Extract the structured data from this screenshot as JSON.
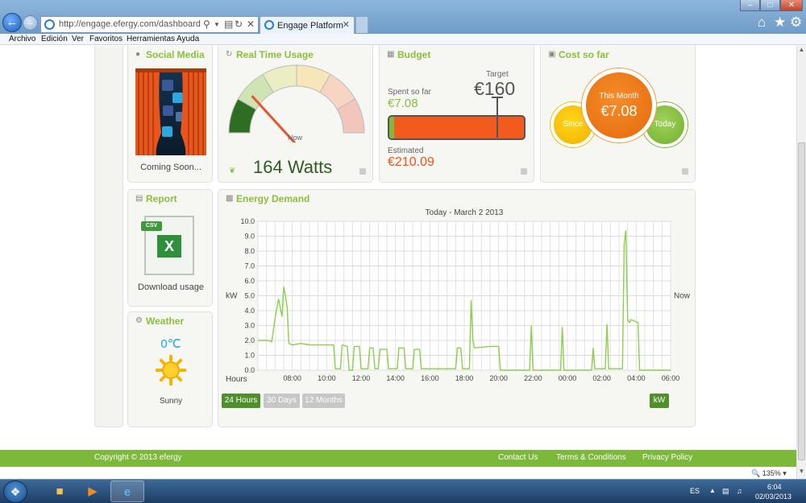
{
  "browser": {
    "url": "http://engage.efergy.com/dashboard",
    "tab_title": "Engage Platform",
    "menu": [
      "Archivo",
      "Edición",
      "Ver",
      "Favoritos",
      "Herramientas",
      "Ayuda"
    ]
  },
  "social": {
    "title": "Social Media",
    "caption": "Coming Soon..."
  },
  "realtime": {
    "title": "Real Time Usage",
    "now_label": "Now",
    "value": "164 Watts",
    "gauge_level": 0.1
  },
  "budget": {
    "title": "Budget",
    "target_label": "Target",
    "target_value": "€160",
    "spent_label": "Spent so far",
    "spent_value": "€7.08",
    "spent_fraction": 0.034,
    "estimated_label": "Estimated",
    "estimated_value": "€210.09"
  },
  "cost": {
    "title": "Cost so far",
    "since_label": "Since",
    "month_label": "This Month",
    "month_value": "€7.08",
    "today_label": "Today"
  },
  "report": {
    "title": "Report",
    "badge": "CSV",
    "caption": "Download usage"
  },
  "weather": {
    "title": "Weather",
    "temp": "0℃",
    "description": "Sunny"
  },
  "energy": {
    "title": "Energy Demand",
    "buttons": [
      "24 Hours",
      "30 Days",
      "12 Months"
    ],
    "unit_button": "kW"
  },
  "chart_data": {
    "type": "line",
    "title": "Today - March 2 2013",
    "xlabel": "Hours",
    "ylabel": "kW",
    "right_label": "Now",
    "xlim": [
      6,
      30
    ],
    "ylim": [
      0,
      10
    ],
    "yticks": [
      "0.0",
      "1.0",
      "2.0",
      "3.0",
      "4.0",
      "5.0",
      "6.0",
      "7.0",
      "8.0",
      "9.0",
      "10.0"
    ],
    "xticks": [
      {
        "x": 8,
        "label": "08:00"
      },
      {
        "x": 10,
        "label": "10:00"
      },
      {
        "x": 12,
        "label": "12:00"
      },
      {
        "x": 14,
        "label": "14:00"
      },
      {
        "x": 16,
        "label": "16:00"
      },
      {
        "x": 18,
        "label": "18:00"
      },
      {
        "x": 20,
        "label": "20:00"
      },
      {
        "x": 22,
        "label": "22:00"
      },
      {
        "x": 24,
        "label": "00:00"
      },
      {
        "x": 26,
        "label": "02:00"
      },
      {
        "x": 28,
        "label": "04:00"
      },
      {
        "x": 30,
        "label": "06:00"
      }
    ],
    "grid": true,
    "color": "#8ccf4c",
    "series": [
      {
        "points": [
          [
            6,
            2.0
          ],
          [
            6.6,
            2.0
          ],
          [
            6.8,
            1.9
          ],
          [
            7.0,
            3.5
          ],
          [
            7.2,
            4.8
          ],
          [
            7.4,
            3.6
          ],
          [
            7.5,
            5.6
          ],
          [
            7.6,
            5.0
          ],
          [
            7.7,
            4.2
          ],
          [
            7.8,
            1.8
          ],
          [
            8.0,
            1.7
          ],
          [
            8.5,
            1.8
          ],
          [
            9.0,
            1.7
          ],
          [
            9.5,
            1.7
          ],
          [
            10.0,
            1.7
          ],
          [
            10.4,
            1.7
          ],
          [
            10.5,
            0.1
          ],
          [
            10.8,
            0.1
          ],
          [
            10.9,
            1.7
          ],
          [
            11.2,
            1.6
          ],
          [
            11.3,
            0.0
          ],
          [
            11.5,
            0.0
          ],
          [
            11.6,
            1.6
          ],
          [
            11.9,
            1.6
          ],
          [
            12.0,
            0.1
          ],
          [
            12.4,
            0.1
          ],
          [
            12.5,
            1.5
          ],
          [
            12.7,
            1.5
          ],
          [
            12.8,
            0.1
          ],
          [
            13.0,
            0.1
          ],
          [
            13.1,
            1.4
          ],
          [
            13.5,
            1.4
          ],
          [
            13.6,
            0.1
          ],
          [
            14.1,
            0.1
          ],
          [
            14.2,
            1.5
          ],
          [
            14.5,
            1.5
          ],
          [
            14.6,
            0.1
          ],
          [
            15.0,
            0.1
          ],
          [
            15.1,
            1.4
          ],
          [
            15.4,
            1.4
          ],
          [
            15.5,
            0.1
          ],
          [
            17.5,
            0.1
          ],
          [
            17.6,
            1.5
          ],
          [
            17.8,
            1.5
          ],
          [
            17.9,
            0.1
          ],
          [
            18.3,
            0.1
          ],
          [
            18.4,
            4.7
          ],
          [
            18.5,
            2.0
          ],
          [
            18.6,
            1.5
          ],
          [
            19.5,
            1.6
          ],
          [
            20.0,
            1.6
          ],
          [
            20.1,
            0.0
          ],
          [
            21.8,
            0.0
          ],
          [
            21.9,
            3.0
          ],
          [
            22.0,
            0.0
          ],
          [
            23.6,
            0.0
          ],
          [
            23.7,
            2.9
          ],
          [
            23.8,
            0.0
          ],
          [
            25.4,
            0.0
          ],
          [
            25.5,
            1.5
          ],
          [
            25.6,
            0.1
          ],
          [
            26.2,
            0.1
          ],
          [
            26.3,
            3.1
          ],
          [
            26.4,
            0.1
          ],
          [
            27.2,
            0.1
          ],
          [
            27.3,
            8.5
          ],
          [
            27.4,
            9.4
          ],
          [
            27.5,
            3.4
          ],
          [
            27.6,
            3.2
          ],
          [
            27.7,
            3.4
          ],
          [
            28.1,
            3.2
          ],
          [
            28.2,
            0.0
          ],
          [
            30.0,
            0.0
          ]
        ]
      }
    ]
  },
  "footer": {
    "copyright": "Copyright © 2013 efergy",
    "links": [
      "Contact Us",
      "Terms & Conditions",
      "Privacy Policy"
    ]
  },
  "status": {
    "zoom": "135%"
  },
  "taskbar": {
    "lang": "ES",
    "time": "6:04",
    "date": "02/03/2013"
  }
}
